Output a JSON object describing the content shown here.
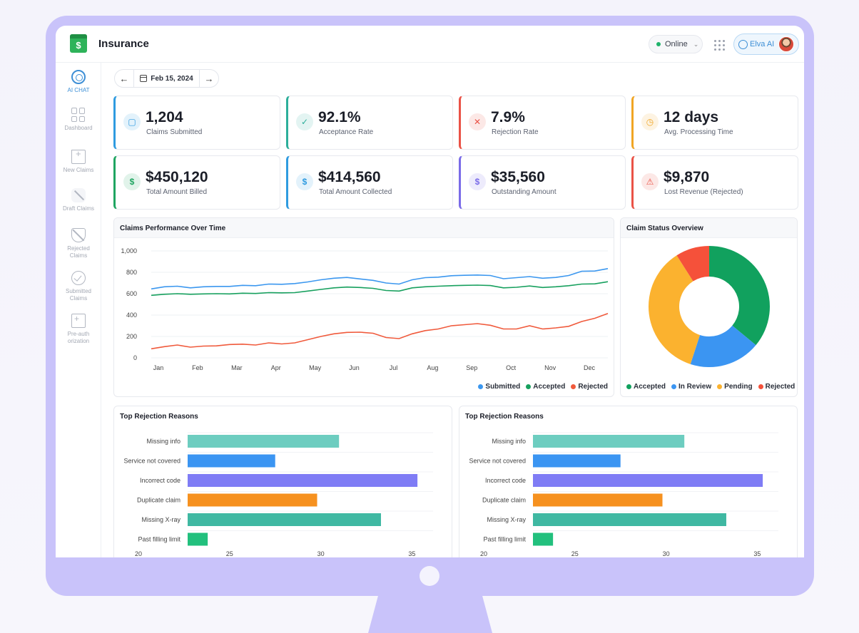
{
  "app": {
    "title": "Insurance"
  },
  "header": {
    "status": "Online",
    "assistant_label": "Elva AI"
  },
  "sidebar": {
    "items": [
      {
        "label": "AI CHAT",
        "icon": "ai-chat-icon",
        "active": true
      },
      {
        "label": "Dashboard",
        "icon": "dashboard-icon"
      },
      {
        "label": "New Claims",
        "icon": "new-claims-icon"
      },
      {
        "label": "Draft Claims",
        "icon": "draft-claims-icon"
      },
      {
        "label": "Rejected Claims",
        "icon": "rejected-claims-icon"
      },
      {
        "label": "Submitted Claims",
        "icon": "submitted-claims-icon"
      },
      {
        "label": "Pre-authorization",
        "icon": "pre-authorization-icon"
      }
    ]
  },
  "date_nav": {
    "date": "Feb 15, 2024"
  },
  "kpis": [
    {
      "value": "1,204",
      "label": "Claims Submitted",
      "color": "#2f9be0",
      "icon": "folder-icon"
    },
    {
      "value": "92.1%",
      "label": "Acceptance Rate",
      "color": "#2cae9a",
      "icon": "check-circle-icon"
    },
    {
      "value": "7.9%",
      "label": "Rejection Rate",
      "color": "#ea5246",
      "icon": "x-circle-icon"
    },
    {
      "value": "12 days",
      "label": "Avg. Processing Time",
      "color": "#f0a524",
      "icon": "clock-icon"
    },
    {
      "value": "$450,120",
      "label": "Total Amount Billed",
      "color": "#1fa561",
      "icon": "dollar-icon"
    },
    {
      "value": "$414,560",
      "label": "Total Amount Collected",
      "color": "#2f9be0",
      "icon": "dollar-icon"
    },
    {
      "value": "$35,560",
      "label": "Outstanding Amount",
      "color": "#7a6be8",
      "icon": "dollar-icon"
    },
    {
      "value": "$9,870",
      "label": "Lost Revenue (Rejected)",
      "color": "#ea5246",
      "icon": "warning-icon"
    }
  ],
  "chart_data": [
    {
      "type": "line",
      "title": "Claims Performance Over Time",
      "x": [
        "Jan",
        "Jan",
        "Jan",
        "Feb",
        "Feb",
        "Feb",
        "Mar",
        "Mar",
        "Mar",
        "Apr",
        "Apr",
        "Apr",
        "May",
        "May",
        "May",
        "Jun",
        "Jun",
        "Jun",
        "Jul",
        "Jul",
        "Jul",
        "Aug",
        "Aug",
        "Aug",
        "Sep",
        "Sep",
        "Sep",
        "Oct",
        "Oct",
        "Oct",
        "Nov",
        "Nov",
        "Nov",
        "Dec",
        "Dec",
        "Dec"
      ],
      "categories": [
        "Jan",
        "Feb",
        "Mar",
        "Apr",
        "May",
        "Jun",
        "Jul",
        "Aug",
        "Sep",
        "Oct",
        "Nov",
        "Dec"
      ],
      "ylim": [
        0,
        1000
      ],
      "yticks": [
        "0",
        "200",
        "400",
        "600",
        "800",
        "1,000"
      ],
      "series": [
        {
          "name": "Submitted",
          "color": "#3b97ef",
          "values": [
            645,
            665,
            670,
            655,
            665,
            668,
            668,
            678,
            675,
            690,
            688,
            695,
            710,
            730,
            745,
            752,
            738,
            725,
            700,
            690,
            730,
            750,
            755,
            768,
            772,
            775,
            770,
            740,
            750,
            760,
            745,
            752,
            770,
            810,
            812,
            835
          ]
        },
        {
          "name": "Accepted",
          "color": "#17a05e",
          "values": [
            585,
            595,
            600,
            595,
            598,
            600,
            598,
            605,
            602,
            610,
            608,
            610,
            625,
            640,
            655,
            662,
            658,
            650,
            630,
            625,
            655,
            665,
            670,
            675,
            678,
            680,
            676,
            655,
            660,
            672,
            658,
            665,
            675,
            690,
            692,
            712
          ]
        },
        {
          "name": "Rejected",
          "color": "#f05a3c",
          "values": [
            85,
            105,
            120,
            100,
            110,
            112,
            125,
            128,
            120,
            140,
            130,
            140,
            170,
            200,
            225,
            238,
            240,
            230,
            190,
            180,
            225,
            255,
            270,
            300,
            310,
            320,
            305,
            270,
            270,
            300,
            270,
            280,
            295,
            340,
            370,
            415
          ]
        }
      ],
      "grid": true,
      "legend": "bottom-right"
    },
    {
      "type": "pie",
      "title": "Claim Status Overview",
      "categories": [
        "Accepted",
        "In Review",
        "Pending",
        "Rejected"
      ],
      "values": [
        36,
        19,
        36,
        9
      ],
      "colors": [
        "#11a15e",
        "#3b95f2",
        "#fbb22f",
        "#f5513a"
      ],
      "legend": "bottom"
    },
    {
      "type": "bar",
      "title": "Top Rejection Reasons",
      "categories": [
        "Missing info",
        "Service not covered",
        "Incorrect code",
        "Duplicate claim",
        "Missing X-ray",
        "Past filling limit"
      ],
      "values": [
        31,
        27.5,
        35.3,
        29.8,
        33.3,
        23.8
      ],
      "colors": [
        "#6dcdc0",
        "#3b95f2",
        "#7f7cf5",
        "#f6911f",
        "#3fb8a2",
        "#22c07d"
      ],
      "xlim": [
        20,
        36
      ],
      "xticks": [
        "20",
        "25",
        "30",
        "35"
      ]
    },
    {
      "type": "bar",
      "title": "Top Rejection Reasons",
      "categories": [
        "Missing info",
        "Service not covered",
        "Incorrect code",
        "Duplicate claim",
        "Missing X-ray",
        "Past filling limit"
      ],
      "values": [
        31,
        27.5,
        35.3,
        29.8,
        33.3,
        23.8
      ],
      "colors": [
        "#6dcdc0",
        "#3b95f2",
        "#7f7cf5",
        "#f6911f",
        "#3fb8a2",
        "#22c07d"
      ],
      "xlim": [
        20,
        36
      ],
      "xticks": [
        "20",
        "25",
        "30",
        "35"
      ]
    }
  ]
}
